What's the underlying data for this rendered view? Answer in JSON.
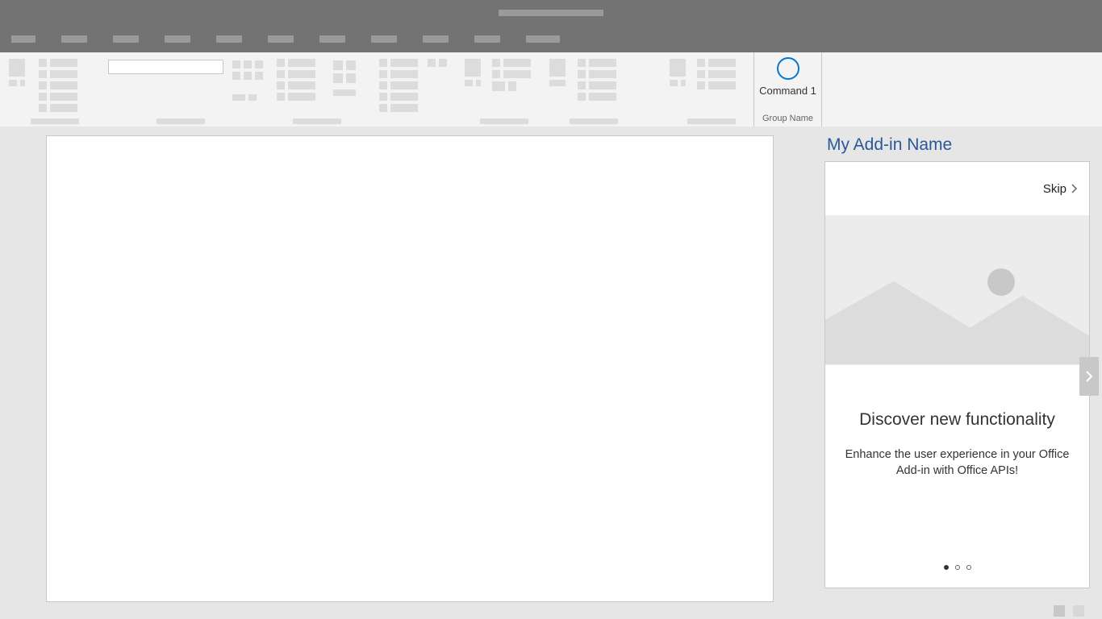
{
  "ribbon": {
    "command_label": "Command 1",
    "group_label": "Group Name"
  },
  "taskpane": {
    "title": "My Add-in Name",
    "skip_label": "Skip",
    "card": {
      "heading": "Discover new functionality",
      "subtext": "Enhance the user experience in your Office Add-in with Office APIs!"
    },
    "page_indicator": {
      "total": 3,
      "active": 0
    }
  }
}
